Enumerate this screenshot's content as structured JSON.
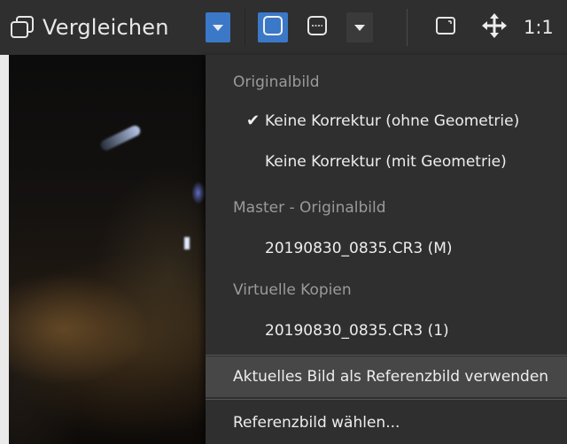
{
  "toolbar": {
    "compare_label": "Vergleichen",
    "zoom_label": "1:1",
    "icons": {
      "compare": "compare-windows-icon",
      "dropdown": "chevron-down-icon",
      "single_view": "single-view-icon",
      "split_view": "split-view-icon",
      "fit": "fit-screen-icon",
      "move": "move-arrows-icon"
    },
    "accent_color": "#3b78c8"
  },
  "menu": {
    "sections": [
      {
        "header": "Originalbild",
        "items": [
          {
            "label": "Keine Korrektur (ohne Geometrie)",
            "checked": true
          },
          {
            "label": "Keine Korrektur (mit Geometrie)",
            "checked": false
          }
        ]
      },
      {
        "header": "Master - Originalbild",
        "items": [
          {
            "label": "20190830_0835.CR3 (M)",
            "checked": false
          }
        ]
      },
      {
        "header": "Virtuelle Kopien",
        "items": [
          {
            "label": "20190830_0835.CR3 (1)",
            "checked": false
          }
        ]
      }
    ],
    "actions": [
      {
        "label": "Aktuelles Bild als Referenzbild verwenden",
        "hovered": true
      },
      {
        "label": "Referenzbild wählen...",
        "hovered": false
      }
    ],
    "check_glyph": "✔"
  }
}
